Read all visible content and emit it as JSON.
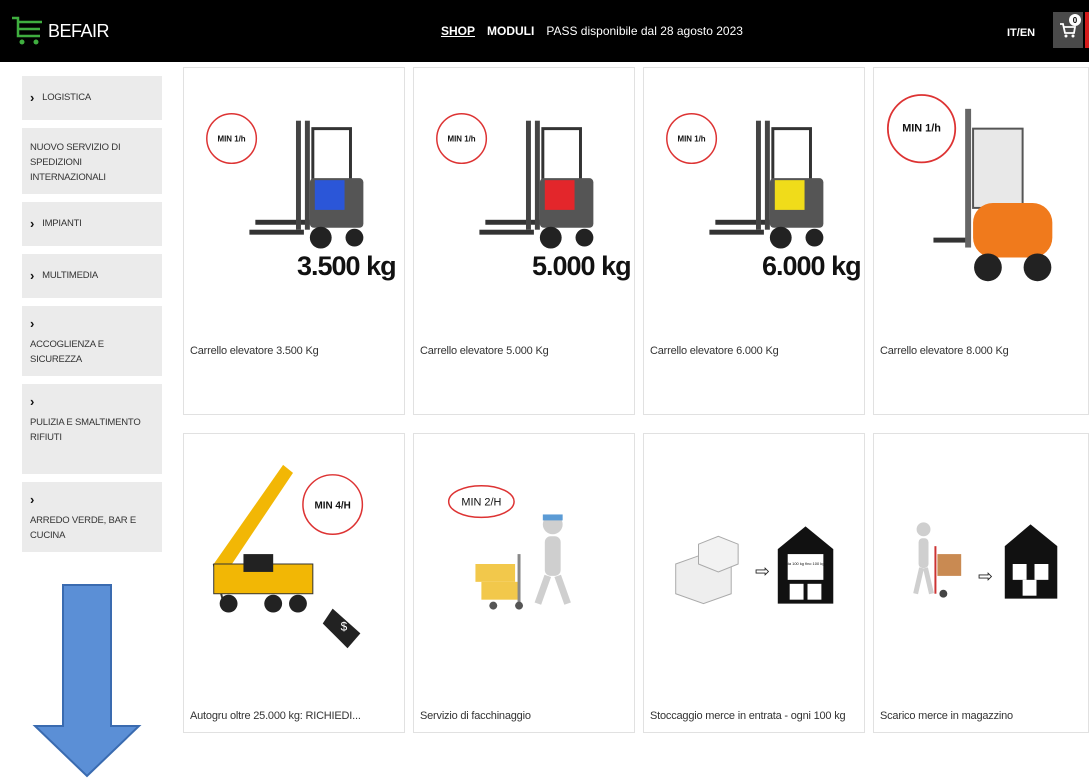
{
  "header": {
    "logo_text": "BEFAIR",
    "nav": [
      {
        "label": "SHOP"
      },
      {
        "label": "MODULI"
      },
      {
        "label": "PASS disponibile dal 28 agosto 2023"
      }
    ],
    "lang": "IT/EN",
    "cart_count": "0"
  },
  "sidebar": {
    "items": [
      {
        "label": "LOGISTICA"
      },
      {
        "label": "NUOVO SERVIZIO DI SPEDIZIONI INTERNAZIONALI"
      },
      {
        "label": "IMPIANTI"
      },
      {
        "label": "MULTIMEDIA"
      },
      {
        "label": "ACCOGLIENZA E SICUREZZA"
      },
      {
        "label": "PULIZIA E SMALTIMENTO RIFIUTI"
      },
      {
        "label": "ARREDO VERDE, BAR E CUCINA"
      }
    ]
  },
  "products": [
    {
      "title": "Carrello elevatore 3.500 Kg",
      "weight": "3.500 kg",
      "badge": "MIN 1/h",
      "color": "#2b56d8"
    },
    {
      "title": "Carrello elevatore 5.000 Kg",
      "weight": "5.000 kg",
      "badge": "MIN 1/h",
      "color": "#e3262b"
    },
    {
      "title": "Carrello elevatore 6.000 Kg",
      "weight": "6.000 kg",
      "badge": "MIN 1/h",
      "color": "#f0dc1a"
    },
    {
      "title": "Carrello elevatore 8.000 Kg",
      "badge": "MIN 1/h",
      "color": "#f07a1c"
    },
    {
      "title": "Autogru oltre 25.000 kg: RICHIEDI...",
      "badge": "MIN 4/H",
      "color": "#f2b705"
    },
    {
      "title": "Servizio di facchinaggio",
      "badge": "MIN 2/H",
      "color": "#f2c84b"
    },
    {
      "title": "Stoccaggio merce in entrata - ogni 100 kg",
      "warehouse_text": "da 100 kg fino 100 kg"
    },
    {
      "title": "Scarico merce in magazzino"
    }
  ],
  "colors": {
    "header_bg": "#000000",
    "accent_red": "#d31b1b",
    "sidebar_bg": "#ebebeb",
    "arrow_fill": "#5b8fd6",
    "arrow_stroke": "#3a6bb0"
  }
}
